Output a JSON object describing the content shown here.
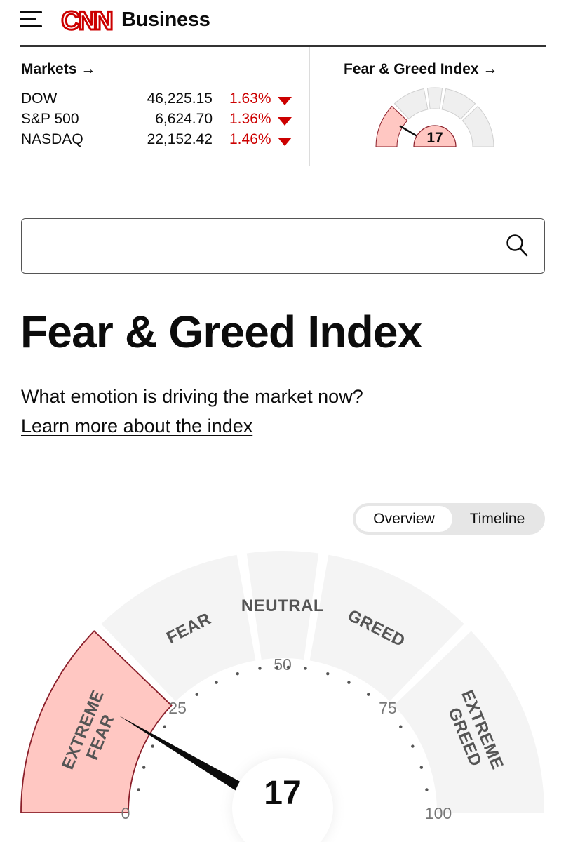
{
  "header": {
    "logo_text": "CNN",
    "section": "Business"
  },
  "markets": {
    "link_label": "Markets",
    "arrow": "→",
    "rows": [
      {
        "name": "DOW",
        "value": "46,225.15",
        "change": "1.63%",
        "direction": "down"
      },
      {
        "name": "S&P 500",
        "value": "6,624.70",
        "change": "1.36%",
        "direction": "down"
      },
      {
        "name": "NASDAQ",
        "value": "22,152.42",
        "change": "1.46%",
        "direction": "down"
      }
    ]
  },
  "fg_mini": {
    "link_label": "Fear & Greed Index",
    "arrow": "→",
    "value": "17"
  },
  "search": {
    "placeholder": "",
    "value": ""
  },
  "page": {
    "title": "Fear & Greed Index",
    "subtitle": "What emotion is driving the market now?",
    "learn_link": "Learn more about the index"
  },
  "tabs": {
    "overview": "Overview",
    "timeline": "Timeline",
    "selected": "Overview"
  },
  "gauge": {
    "value": 17,
    "value_label": "17",
    "ticks": [
      "0",
      "25",
      "50",
      "75",
      "100"
    ],
    "segments": [
      {
        "label": "EXTREME FEAR",
        "lines": [
          "EXTREME",
          "FEAR"
        ],
        "active": true
      },
      {
        "label": "FEAR",
        "lines": [
          "FEAR"
        ],
        "active": false
      },
      {
        "label": "NEUTRAL",
        "lines": [
          "NEUTRAL"
        ],
        "active": false
      },
      {
        "label": "GREED",
        "lines": [
          "GREED"
        ],
        "active": false
      },
      {
        "label": "EXTREME GREED",
        "lines": [
          "EXTREME",
          "GREED"
        ],
        "active": false
      }
    ]
  },
  "colors": {
    "brand_red": "#cc0000",
    "active_fill": "#ffc7c2",
    "active_stroke": "#8b1f2a",
    "inactive_fill": "#f4f4f4",
    "label_gray": "#555555"
  },
  "icons": [
    "menu-icon",
    "search-icon",
    "arrow-right-icon",
    "down-triangle-icon"
  ]
}
